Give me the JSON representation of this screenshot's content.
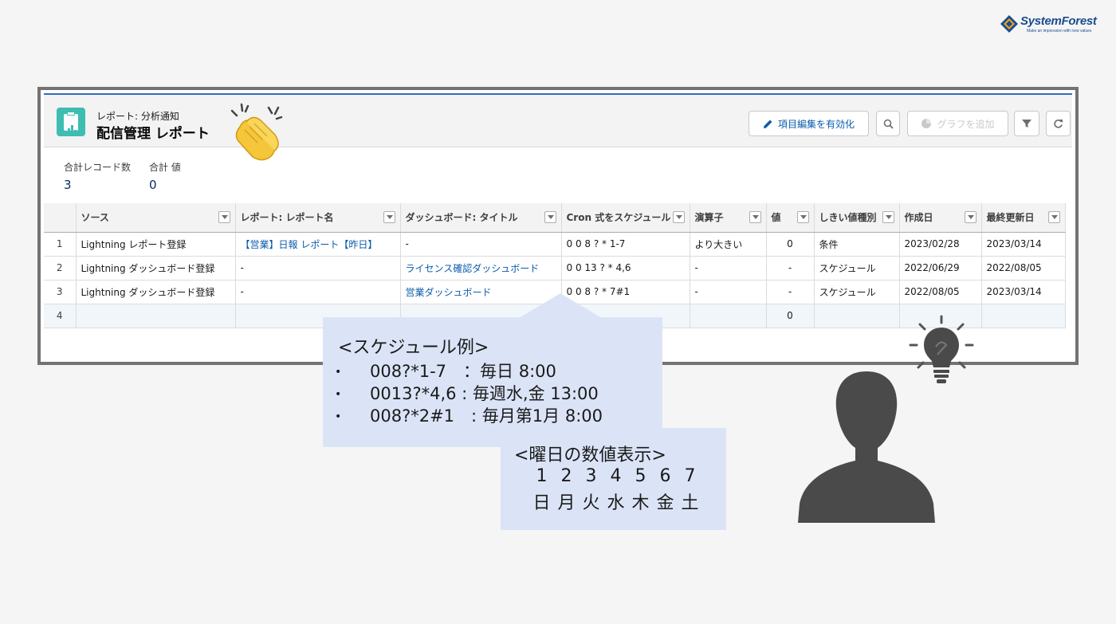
{
  "logo": {
    "name": "SystemForest",
    "tagline": "Make an impression with new values"
  },
  "report": {
    "subtitle": "レポート: 分析通知",
    "title": "配信管理 レポート",
    "accent_color": "#3ebdb2",
    "toolbar": {
      "edit_label": "項目編集を有効化",
      "chart_label": "グラフを追加"
    },
    "summary": {
      "record_count_label": "合計レコード数",
      "record_count_value": "3",
      "total_value_label": "合計 値",
      "total_value_value": "0"
    },
    "columns": [
      "ソース",
      "レポート: レポート名",
      "ダッシュボード: タイトル",
      "Cron 式をスケジュール",
      "演算子",
      "値",
      "しきい値種別",
      "作成日",
      "最終更新日"
    ],
    "rows": [
      {
        "num": "1",
        "source": "Lightning レポート登録",
        "report_name": "【営業】日報 レポート【昨日】",
        "dashboard_title": "-",
        "cron": "0 0 8 ? * 1-7",
        "operator": "より大きい",
        "value": "0",
        "threshold_type": "条件",
        "created": "2023/02/28",
        "modified": "2023/03/14"
      },
      {
        "num": "2",
        "source": "Lightning ダッシュボード登録",
        "report_name": "-",
        "dashboard_title": "ライセンス確認ダッシュボード",
        "cron": "0 0 13 ? * 4,6",
        "operator": "-",
        "value": "-",
        "threshold_type": "スケジュール",
        "created": "2022/06/29",
        "modified": "2022/08/05"
      },
      {
        "num": "3",
        "source": "Lightning ダッシュボード登録",
        "report_name": "-",
        "dashboard_title": "営業ダッシュボード",
        "cron": "0 0 8 ? * 7#1",
        "operator": "-",
        "value": "-",
        "threshold_type": "スケジュール",
        "created": "2022/08/05",
        "modified": "2023/03/14"
      }
    ],
    "total_row": {
      "num": "4",
      "value": "0"
    }
  },
  "schedule_callout": {
    "title": "<スケジュール例>",
    "items": [
      {
        "bullet": "•",
        "text": "008?*1-7　：毎日 8:00"
      },
      {
        "bullet": "•",
        "text": "0013?*4,6 : 毎週水,金 13:00"
      },
      {
        "bullet": "•",
        "text": "008?*2#1　: 毎月第1月 8:00"
      }
    ]
  },
  "weekday_callout": {
    "title": "<曜日の数値表示>",
    "numbers": [
      "1",
      "2",
      "3",
      "4",
      "5",
      "6",
      "7"
    ],
    "days": [
      "日",
      "月",
      "火",
      "水",
      "木",
      "金",
      "土"
    ]
  }
}
